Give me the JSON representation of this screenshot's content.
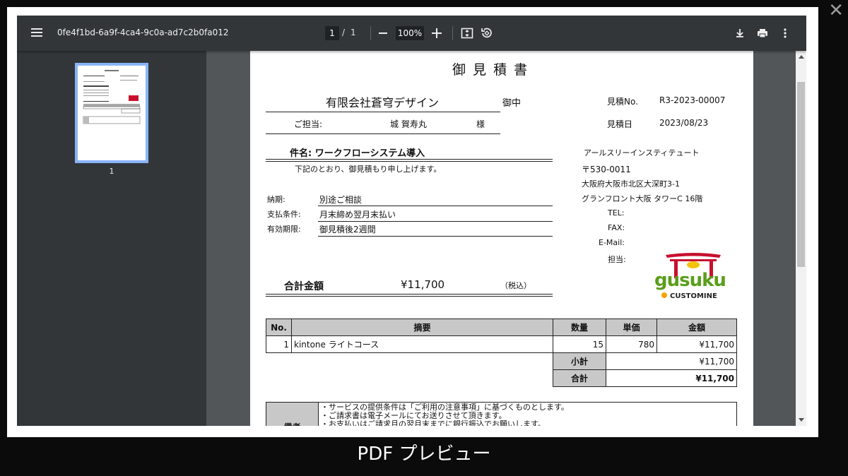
{
  "viewer": {
    "file_title": "0fe4f1bd-6a9f-4ca4-9c0a-ad7c2b0fa012",
    "current_page": "1",
    "page_sep": "/",
    "total_pages": "1",
    "zoom": "100%",
    "thumb_label": "1"
  },
  "doc": {
    "title": "御 見 積 書",
    "customer": "有限会社蒼穹デザイン",
    "onchu": "御中",
    "est_no_label": "見積No.",
    "est_no": "R3-2023-00007",
    "tanto_label": "ご担当:",
    "tanto_name": "城 賀寿丸",
    "sama": "様",
    "date_label": "見積日",
    "date": "2023/08/23",
    "subject": "件名: ワークフローシステム導入",
    "intro": "下記のとおり、御見積もり申し上げます。",
    "terms": [
      {
        "label": "納期:",
        "value": "別途ご相談"
      },
      {
        "label": "支払条件:",
        "value": "月末締め翌月末払い"
      },
      {
        "label": "有効期限:",
        "value": "御見積後2週間"
      }
    ],
    "total_label": "合計金額",
    "total_value": "¥11,700",
    "tax_note": "（税込）",
    "company": {
      "name": "アールスリーインスティテュート",
      "zip": "〒530-0011",
      "addr1": "大阪府大阪市北区大深町3-1",
      "addr2": "グランフロント大阪 タワーC 16階",
      "tel_label": "TEL:",
      "fax_label": "FAX:",
      "email_label": "E-Mail:",
      "person_label": "担当:"
    },
    "logo": {
      "text": "gusuku",
      "sub": "CUSTOMINE"
    },
    "table": {
      "headers": [
        "No.",
        "摘要",
        "数量",
        "単価",
        "金額"
      ],
      "rows": [
        {
          "no": "1",
          "desc": "kintone ライトコース",
          "qty": "15",
          "price": "780",
          "amount": "¥11,700"
        }
      ],
      "subtotal_label": "小計",
      "subtotal": "¥11,700",
      "total_label": "合計",
      "total": "¥11,700"
    },
    "remarks_label": "備考",
    "remarks": [
      "・サービスの提供条件は「ご利用の注意事項」に基づくものとします。",
      "・ご請求書は電子メールにてお送りさせて頂きます。",
      "・お支払いはご請求月の翌月末までに銀行振込でお願いします。"
    ]
  },
  "caption": "PDF プレビュー",
  "colors": {
    "toolbar": "#323639",
    "viewer_bg": "#525659",
    "thumb_border": "#8ab4f8",
    "table_header": "#c8c8c8",
    "logo_red": "#c8102e",
    "logo_green": "#5a9e1b"
  }
}
